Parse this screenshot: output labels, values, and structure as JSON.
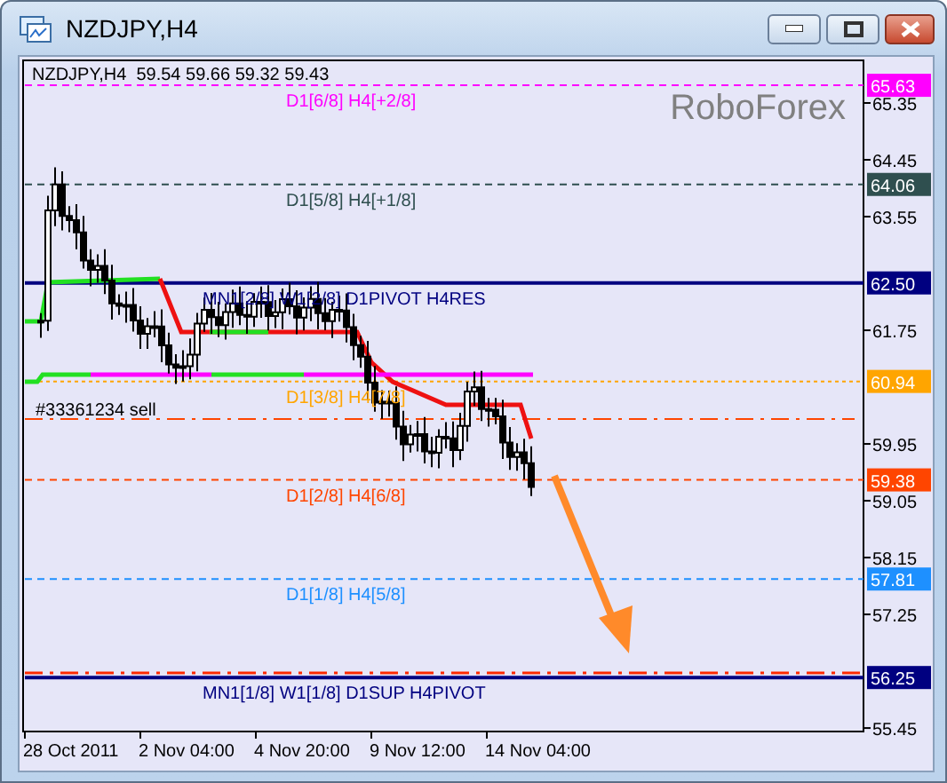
{
  "window": {
    "title": "NZDJPY,H4"
  },
  "chart": {
    "header": "NZDJPY,H4  59.54 59.66 59.32 59.43",
    "brand": "RoboForex",
    "order_label": "#33361234 sell",
    "levels": [
      {
        "label": "D1[6/8] H4[+2/8]",
        "price": "65.63",
        "color": "#ff00ff",
        "kind": "dashed"
      },
      {
        "label": "D1[5/8] H4[+1/8]",
        "price": "64.06",
        "color": "#2f4f4f",
        "kind": "dashed"
      },
      {
        "label": "MN1[2/8] W1[2/8] D1PIVOT H4RES",
        "price": "62.50",
        "color": "#000080",
        "kind": "solid"
      },
      {
        "label": "D1[3/8] H4[7/8]",
        "price": "60.94",
        "color": "#ffa500",
        "kind": "dotted"
      },
      {
        "label": "D1[2/8] H4[6/8]",
        "price": "59.38",
        "color": "#ff4500",
        "kind": "dashed"
      },
      {
        "label": "D1[1/8] H4[5/8]",
        "price": "57.81",
        "color": "#1e90ff",
        "kind": "dashed"
      },
      {
        "label": "MN1[1/8] W1[1/8] D1SUP H4PIVOT",
        "price": "56.25",
        "color": "#000080",
        "kind": "solid"
      }
    ],
    "price_ticks": [
      "65.35",
      "64.45",
      "63.55",
      "61.75",
      "59.95",
      "59.05",
      "58.15",
      "57.25",
      "55.45"
    ],
    "time_labels": [
      "28 Oct 2011",
      "2 Nov 04:00",
      "4 Nov 20:00",
      "9 Nov 12:00",
      "14 Nov 04:00"
    ]
  }
}
